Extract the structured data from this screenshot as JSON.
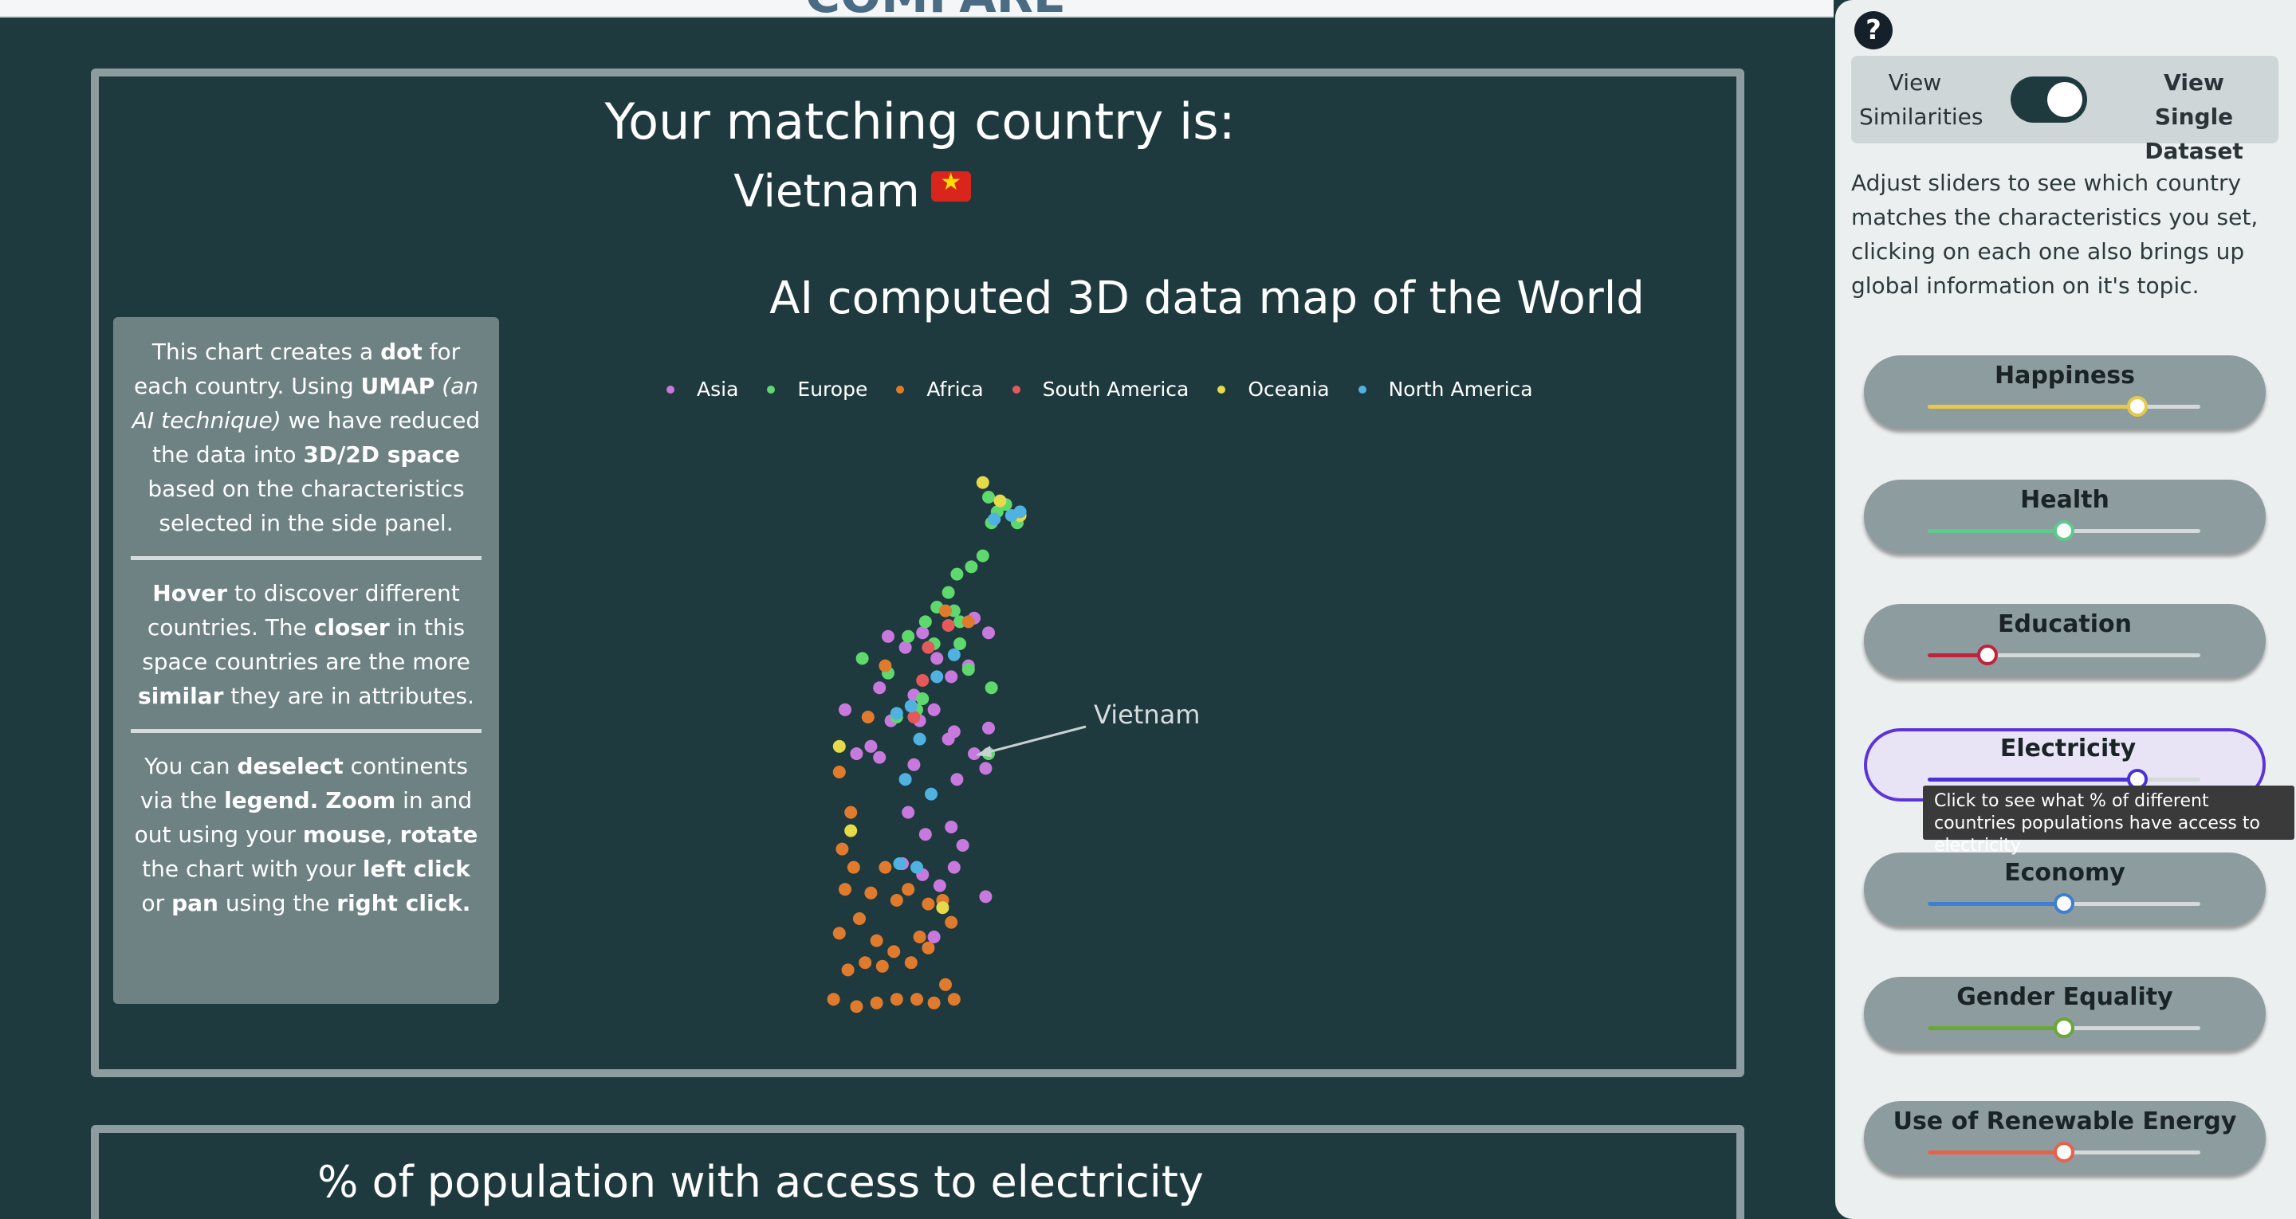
{
  "header": {
    "partial_title": "COMPARE"
  },
  "match": {
    "title": "Your matching country is:",
    "country": "Vietnam"
  },
  "chart": {
    "title": "AI computed 3D data map of the World",
    "annotation": "Vietnam"
  },
  "info": {
    "p1": [
      "This chart creates a ",
      "dot",
      " for each country. Using ",
      "UMAP",
      " ",
      "(an AI technique)",
      " we have reduced the data into ",
      "3D/2D space",
      " based on the characteristics selected in the side panel."
    ],
    "p2": [
      "Hover",
      " to discover different countries. The ",
      "closer",
      " in this space countries are the more ",
      "similar",
      " they are in attributes."
    ],
    "p3": [
      "You can ",
      "deselect",
      " continents via the ",
      "legend.",
      " ",
      "Zoom",
      " in and out using your ",
      "mouse",
      ", ",
      "rotate",
      " the chart with your ",
      "left click",
      " or ",
      "pan",
      " using the ",
      "right click."
    ]
  },
  "second_panel": {
    "title": "% of population with access to electricity"
  },
  "sidebar": {
    "toggle_left": "View Similarities",
    "toggle_right": "View Single Dataset",
    "description": "Adjust sliders to see which country matches the characteristics you set, clicking on each one also brings up global information on it's topic.",
    "sliders": [
      {
        "label": "Happiness",
        "value": 0.77,
        "color": "#e8c84a"
      },
      {
        "label": "Health",
        "value": 0.5,
        "color": "#5ec98e"
      },
      {
        "label": "Education",
        "value": 0.22,
        "color": "#c0233b"
      },
      {
        "label": "Electricity",
        "value": 0.77,
        "color": "#4a32d6"
      },
      {
        "label": "Economy",
        "value": 0.5,
        "color": "#3f7fd1"
      },
      {
        "label": "Gender Equality",
        "value": 0.5,
        "color": "#6aa63a"
      },
      {
        "label": "Use of Renewable Energy",
        "value": 0.5,
        "color": "#e8614c"
      }
    ],
    "tooltip": "Click to see what % of different countries populations have access to electricity"
  },
  "chart_data": {
    "type": "scatter",
    "title": "AI computed 3D data map of the World",
    "legend_position": "top",
    "series": [
      {
        "name": "Asia",
        "color": "#c879dd",
        "points": [
          [
            -0.2,
            0.6
          ],
          [
            0.5,
            3.7
          ],
          [
            1.0,
            3.3
          ],
          [
            -1.3,
            3.3
          ],
          [
            -1.9,
            2.9
          ],
          [
            -2.5,
            3.2
          ],
          [
            -0.8,
            2.6
          ],
          [
            -0.3,
            2.1
          ],
          [
            0.3,
            2.4
          ],
          [
            -2.8,
            1.8
          ],
          [
            -1.6,
            1.6
          ],
          [
            -0.9,
            1.2
          ],
          [
            -1.4,
            0.9
          ],
          [
            -0.4,
            0.4
          ],
          [
            1.0,
            0.7
          ],
          [
            0.5,
            0.0
          ],
          [
            0.9,
            -0.4
          ],
          [
            -0.1,
            -0.7
          ],
          [
            -2.4,
            0.9
          ],
          [
            -3.1,
            0.2
          ],
          [
            -2.8,
            -0.1
          ],
          [
            -1.6,
            -0.3
          ],
          [
            -1.8,
            -1.6
          ],
          [
            -1.2,
            -2.2
          ],
          [
            -0.3,
            -2.0
          ],
          [
            0.1,
            -2.5
          ],
          [
            -0.2,
            -3.1
          ],
          [
            -0.7,
            -3.6
          ],
          [
            -2.0,
            -3.0
          ],
          [
            -1.3,
            -3.3
          ],
          [
            -4.0,
            1.2
          ],
          [
            -3.6,
            0.0
          ],
          [
            0.9,
            -3.9
          ],
          [
            -0.9,
            -5.0
          ]
        ]
      },
      {
        "name": "Europe",
        "color": "#5fd86e",
        "points": [
          [
            1.0,
            7.0
          ],
          [
            1.3,
            6.6
          ],
          [
            1.1,
            6.3
          ],
          [
            2.0,
            6.3
          ],
          [
            1.6,
            6.8
          ],
          [
            0.8,
            5.4
          ],
          [
            0.4,
            5.1
          ],
          [
            -0.1,
            4.9
          ],
          [
            -0.4,
            4.4
          ],
          [
            -0.8,
            4.0
          ],
          [
            -0.2,
            3.9
          ],
          [
            0.0,
            3.6
          ],
          [
            -1.2,
            3.6
          ],
          [
            -1.8,
            3.2
          ],
          [
            -0.9,
            3.0
          ],
          [
            0.0,
            3.0
          ],
          [
            0.3,
            2.3
          ],
          [
            1.1,
            1.8
          ],
          [
            -1.3,
            1.5
          ],
          [
            -2.5,
            2.2
          ],
          [
            -3.4,
            2.6
          ],
          [
            -2.2,
            1.0
          ],
          [
            -1.5,
            1.2
          ],
          [
            1.0,
            0.0
          ]
        ]
      },
      {
        "name": "Africa",
        "color": "#e07b2e",
        "points": [
          [
            -4.2,
            -0.5
          ],
          [
            -3.8,
            -1.6
          ],
          [
            -4.1,
            -2.6
          ],
          [
            -3.7,
            -3.1
          ],
          [
            -4.0,
            -3.7
          ],
          [
            -3.5,
            -4.5
          ],
          [
            -3.1,
            -3.8
          ],
          [
            -2.6,
            -3.1
          ],
          [
            -2.2,
            -4.0
          ],
          [
            -1.8,
            -3.7
          ],
          [
            -1.1,
            -4.1
          ],
          [
            -0.6,
            -4.0
          ],
          [
            -0.3,
            -4.6
          ],
          [
            -1.1,
            -5.3
          ],
          [
            -1.7,
            -5.7
          ],
          [
            -2.3,
            -5.4
          ],
          [
            -2.7,
            -5.8
          ],
          [
            -3.3,
            -5.7
          ],
          [
            -3.9,
            -5.9
          ],
          [
            -4.4,
            -6.7
          ],
          [
            -3.6,
            -6.9
          ],
          [
            -2.9,
            -6.8
          ],
          [
            -2.2,
            -6.7
          ],
          [
            -1.5,
            -6.7
          ],
          [
            -0.9,
            -6.8
          ],
          [
            -0.2,
            -6.7
          ],
          [
            -4.2,
            -4.9
          ],
          [
            -2.9,
            -5.1
          ],
          [
            -1.4,
            -5.0
          ],
          [
            -0.5,
            -6.3
          ],
          [
            -2.6,
            2.4
          ],
          [
            -3.2,
            1.0
          ],
          [
            0.3,
            3.6
          ],
          [
            -0.5,
            3.9
          ]
        ]
      },
      {
        "name": "South America",
        "color": "#e45a5a",
        "points": [
          [
            -1.3,
            2.0
          ],
          [
            -1.6,
            1.0
          ],
          [
            -0.4,
            3.5
          ],
          [
            -1.1,
            2.9
          ]
        ]
      },
      {
        "name": "Oceania",
        "color": "#e6d94a",
        "points": [
          [
            0.8,
            7.4
          ],
          [
            1.4,
            6.9
          ],
          [
            2.1,
            6.5
          ],
          [
            -4.2,
            0.2
          ],
          [
            -0.6,
            -4.2
          ],
          [
            -3.8,
            -2.1
          ]
        ]
      },
      {
        "name": "North America",
        "color": "#4fb2e0",
        "points": [
          [
            1.2,
            6.4
          ],
          [
            1.8,
            6.5
          ],
          [
            2.1,
            6.6
          ],
          [
            -1.7,
            1.3
          ],
          [
            -2.2,
            1.1
          ],
          [
            -1.4,
            0.4
          ],
          [
            -1.9,
            -0.7
          ],
          [
            -1.0,
            -1.1
          ],
          [
            -2.1,
            -3.0
          ],
          [
            -1.5,
            -3.1
          ],
          [
            -0.8,
            2.1
          ],
          [
            -0.2,
            2.7
          ]
        ]
      }
    ],
    "annotation": {
      "label": "Vietnam",
      "x": 0.5,
      "y": 0.0
    }
  }
}
